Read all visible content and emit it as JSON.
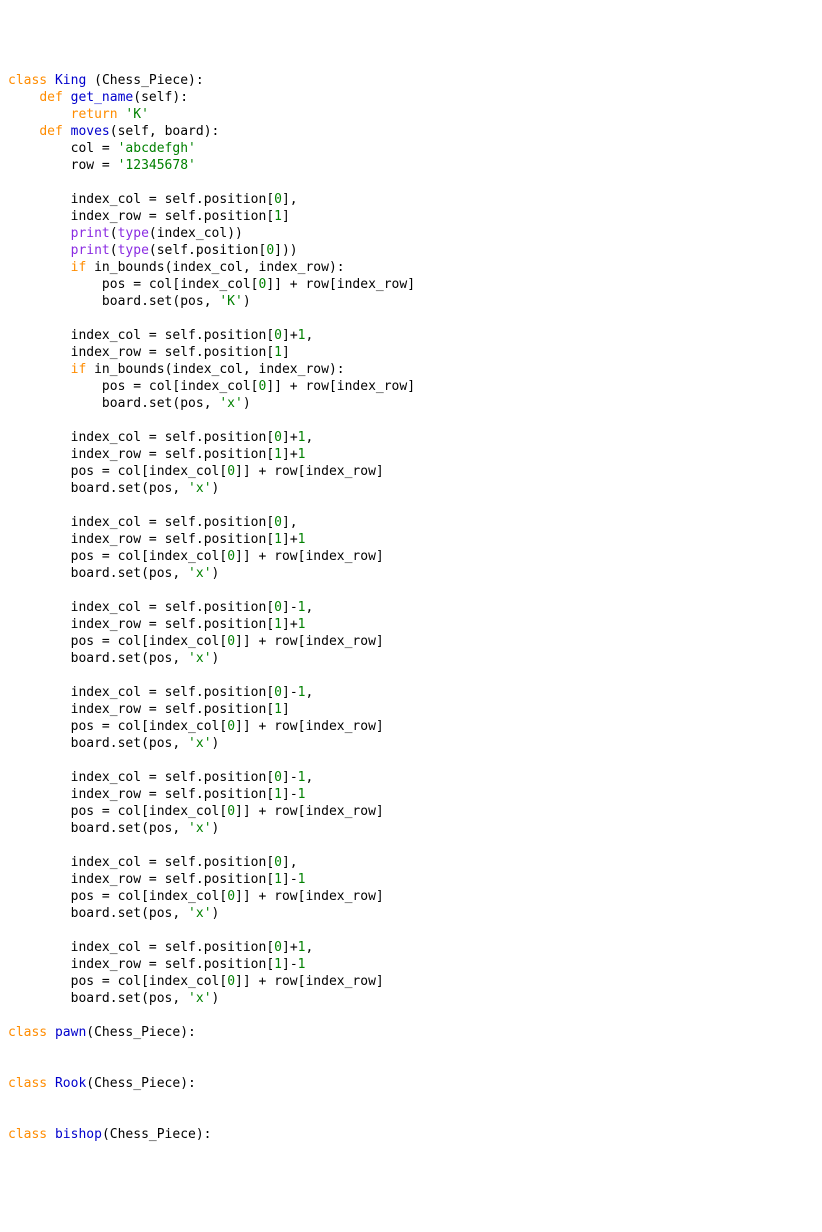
{
  "kw": {
    "class": "class",
    "def": "def",
    "return": "return",
    "if": "if"
  },
  "cls": {
    "king": "King",
    "pawn": "pawn",
    "rook": "Rook",
    "bishop": "bishop",
    "base": "Chess_Piece"
  },
  "fn": {
    "get_name": "get_name",
    "moves": "moves",
    "print": "print",
    "type": "type",
    "in_bounds": "in_bounds",
    "set": "set"
  },
  "param": {
    "self": "self",
    "board": "board"
  },
  "var": {
    "col": "col",
    "row": "row",
    "index_col": "index_col",
    "index_row": "index_row",
    "pos": "pos",
    "position": "position"
  },
  "str": {
    "K": "'K'",
    "abcdefgh": "'abcdefgh'",
    "nums": "'12345678'",
    "x": "'x'"
  },
  "num": {
    "zero": "0",
    "one": "1"
  },
  "op": {
    "eq": " = ",
    "plus": "+",
    "minus": "-",
    "plus_sp": " + "
  }
}
